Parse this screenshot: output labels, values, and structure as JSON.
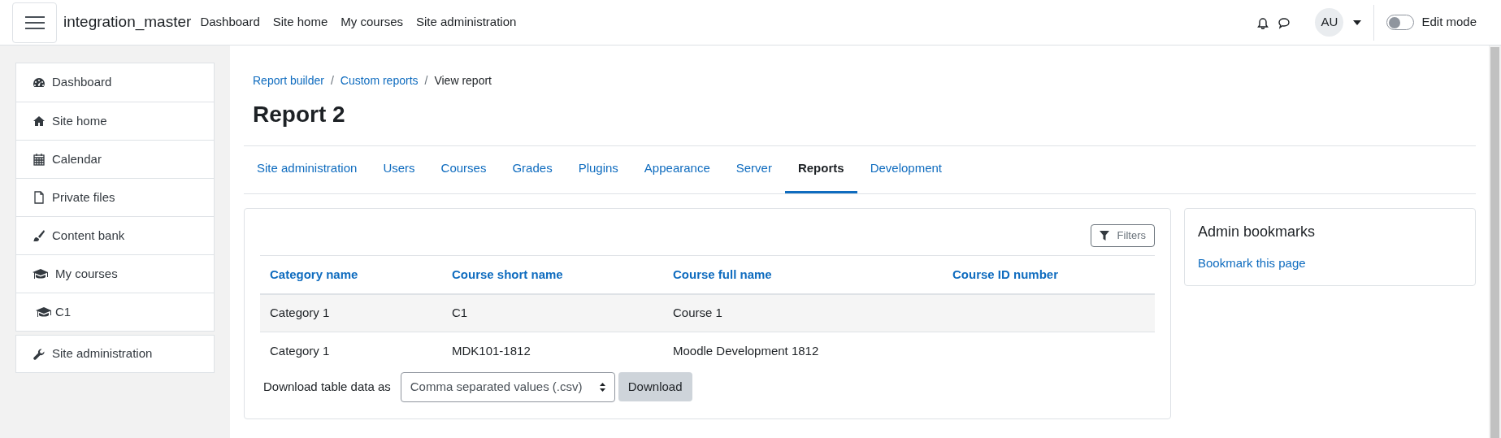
{
  "navbar": {
    "site_name": "integration_master",
    "links": [
      "Dashboard",
      "Site home",
      "My courses",
      "Site administration"
    ],
    "avatar": "AU",
    "edit_mode": {
      "label": "Edit mode",
      "on": false
    }
  },
  "sidebar": {
    "items": [
      {
        "label": "Dashboard",
        "kind": "dashboard"
      },
      {
        "label": "Site home",
        "kind": "home"
      },
      {
        "label": "Calendar",
        "kind": "calendar"
      },
      {
        "label": "Private files",
        "kind": "file"
      },
      {
        "label": "Content bank",
        "kind": "brush"
      },
      {
        "label": "My courses",
        "kind": "cap",
        "children": [
          {
            "label": "C1",
            "kind": "cap"
          }
        ]
      }
    ],
    "admin_item": {
      "label": "Site administration",
      "kind": "wrench"
    }
  },
  "breadcrumbs": [
    {
      "label": "Report builder",
      "kind": "link"
    },
    {
      "label": "/",
      "kind": "separator"
    },
    {
      "label": "Custom reports",
      "kind": "link"
    },
    {
      "label": "/",
      "kind": "separator"
    },
    {
      "label": "View report",
      "kind": "current"
    }
  ],
  "title": "Report 2",
  "tabs": [
    {
      "label": "Site administration",
      "selected": false
    },
    {
      "label": "Users",
      "selected": false
    },
    {
      "label": "Courses",
      "selected": false
    },
    {
      "label": "Grades",
      "selected": false
    },
    {
      "label": "Plugins",
      "selected": false
    },
    {
      "label": "Appearance",
      "selected": false
    },
    {
      "label": "Server",
      "selected": false
    },
    {
      "label": "Reports",
      "selected": true
    },
    {
      "label": "Development",
      "selected": false
    }
  ],
  "report": {
    "filters_button": "Filters",
    "table": {
      "columns": [
        "Category name",
        "Course short name",
        "Course full name",
        "Course ID number"
      ],
      "rows": [
        [
          "Category 1",
          "C1",
          "Course 1",
          ""
        ],
        [
          "Category 1",
          "MDK101-1812",
          "Moodle Development 1812",
          ""
        ]
      ]
    },
    "download": {
      "label": "Download table data as",
      "format": "Comma separated values (.csv)",
      "button": "Download"
    }
  },
  "bookmarks": {
    "title": "Admin bookmarks",
    "link": "Bookmark this page"
  }
}
